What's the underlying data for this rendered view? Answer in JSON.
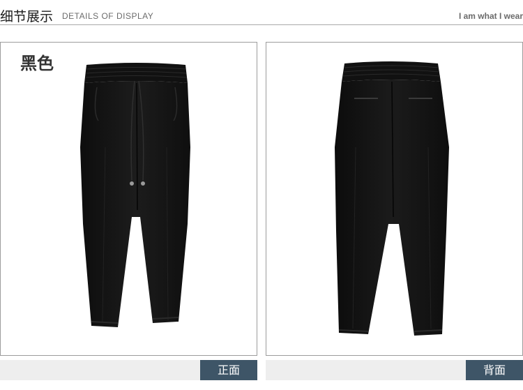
{
  "header": {
    "title_cn": "细节展示",
    "title_en": "DETAILS OF DISPLAY",
    "tagline": "I am what I wear"
  },
  "panels": [
    {
      "color_label": "黑色",
      "view_label": "正面",
      "image": "front-pants-image"
    },
    {
      "color_label": "",
      "view_label": "背面",
      "image": "back-pants-image"
    }
  ],
  "colors": {
    "button_bg": "#3e5567",
    "strip_bg": "#eeeeee",
    "panel_border": "#9c9c9c",
    "garment": "#141414"
  }
}
